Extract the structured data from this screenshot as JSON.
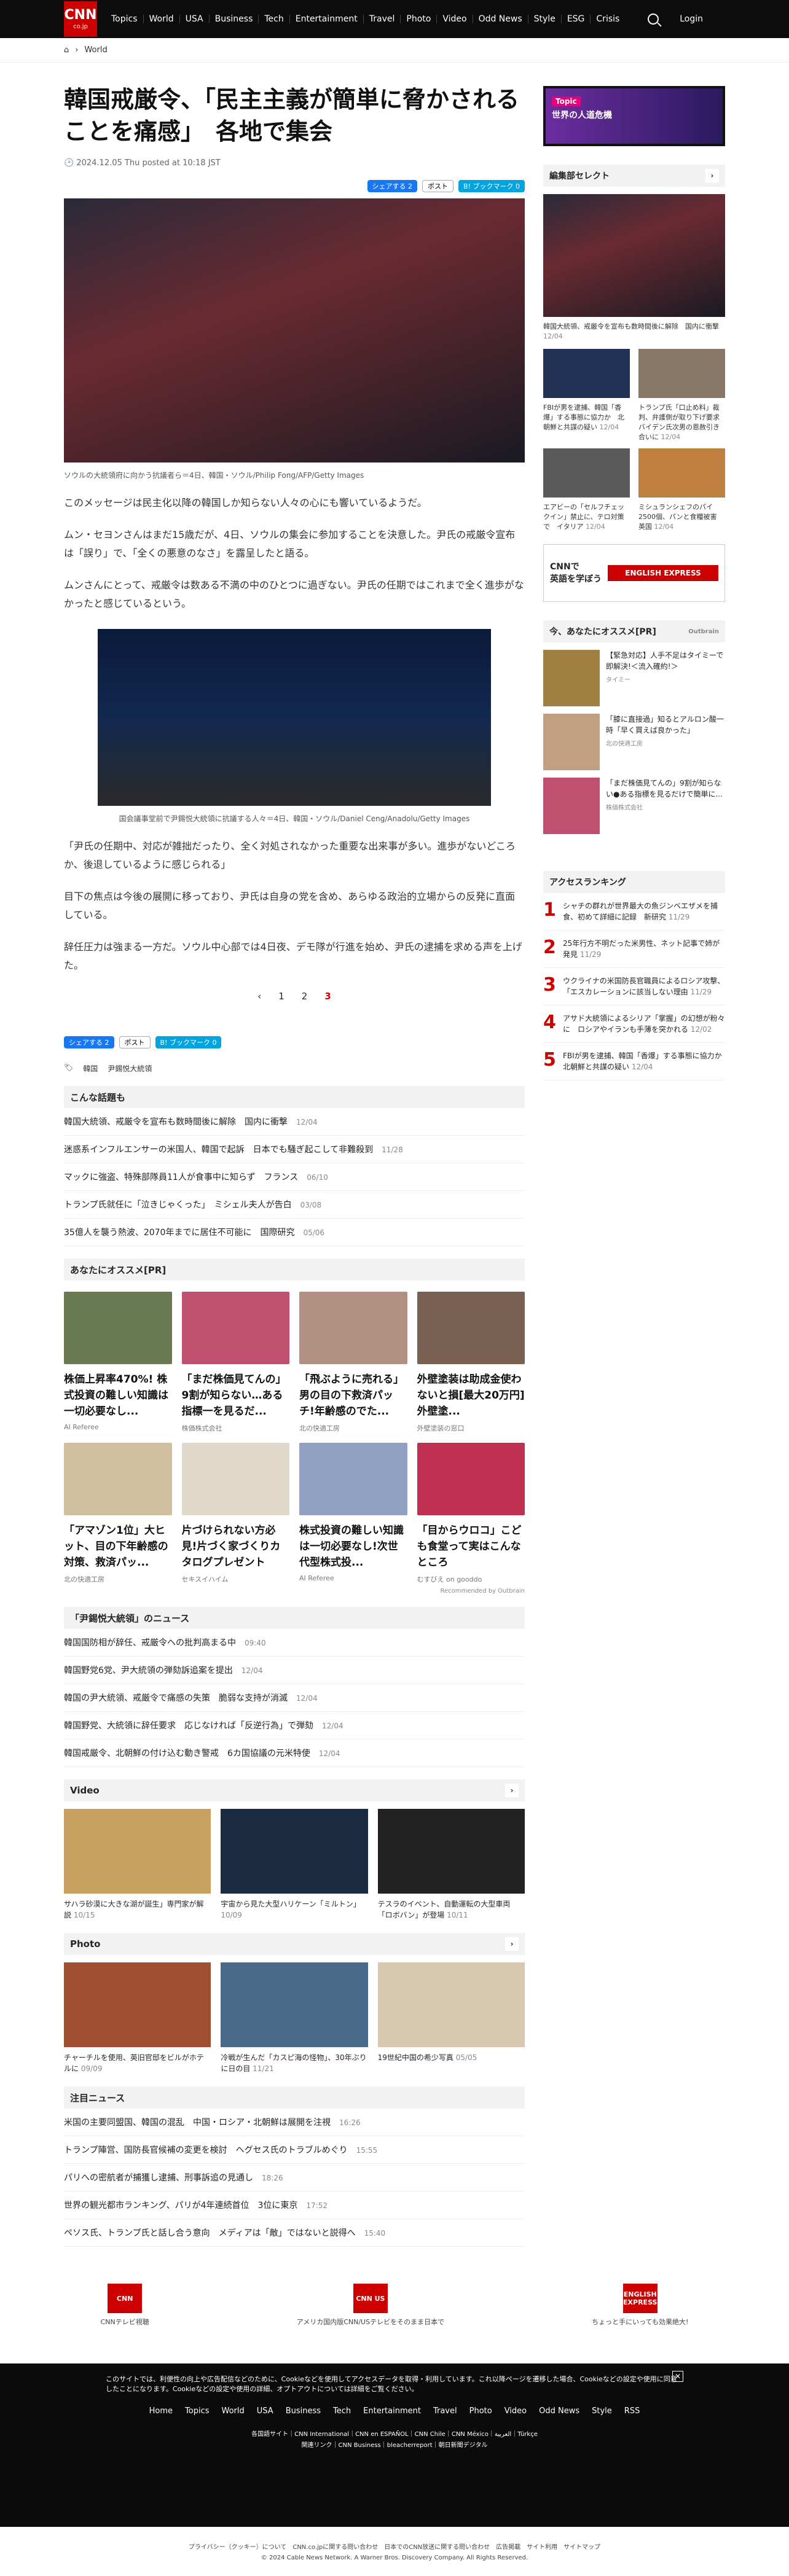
{
  "header": {
    "logo": "CNN",
    "logo_sub": "co.jp",
    "nav": [
      "Topics",
      "World",
      "USA",
      "Business",
      "Tech",
      "Entertainment",
      "Travel",
      "Photo",
      "Video",
      "Odd News",
      "Style",
      "ESG",
      "Crisis"
    ],
    "login": "Login"
  },
  "breadcrumb": {
    "section": "World"
  },
  "article": {
    "title": "韓国戒厳令、「民主主義が簡単に脅かされることを痛感」　各地で集会",
    "date": "2024.12.05 Thu posted at 10:18 JST",
    "share": {
      "fb": "シェアする 2",
      "x": "ポスト",
      "hb": "B! ブックマーク 0"
    },
    "photo1_caption": "ソウルの大統領府に向かう抗議者ら＝4日、韓国・ソウル/Philip Fong/AFP/Getty Images",
    "paras": [
      "このメッセージは民主化以降の韓国しか知らない人々の心にも響いているようだ。",
      "ムン・セヨンさんはまだ15歳だが、4日、ソウルの集会に参加することを決意した。尹氏の戒厳令宣布は「誤り」で、「全くの悪意のなさ」を露呈したと語る。",
      "ムンさんにとって、戒厳令は数ある不満の中のひとつに過ぎない。尹氏の任期ではこれまで全く進歩がなかったと感じているという。"
    ],
    "photo2_caption": "国会議事堂前で尹錫悦大統領に抗議する人々＝4日、韓国・ソウル/Daniel Ceng/Anadolu/Getty Images",
    "paras2": [
      "「尹氏の任期中、対応が雑拙だったり、全く対処されなかった重要な出来事が多い。進歩がないどころか、後退しているように感じられる」",
      "目下の焦点は今後の展開に移っており、尹氏は自身の党を含め、あらゆる政治的立場からの反発に直面している。",
      "辞任圧力は強まる一方だ。ソウル中心部では4日夜、デモ隊が行進を始め、尹氏の逮捕を求める声を上げた。"
    ],
    "pager": [
      "‹",
      "1",
      "2",
      "3"
    ],
    "tags": [
      "韓国",
      "尹錫悦大統領"
    ]
  },
  "related": {
    "title": "こんな話題も",
    "items": [
      {
        "t": "韓国大統領、戒厳令を宣布も数時間後に解除　国内に衝撃",
        "d": "12/04"
      },
      {
        "t": "迷惑系インフルエンサーの米国人、韓国で起訴　日本でも騒ぎ起こして非難殺到",
        "d": "11/28"
      },
      {
        "t": "マックに強盗、特殊部隊員11人が食事中に知らず　フランス",
        "d": "06/10"
      },
      {
        "t": "トランプ氏就任に「泣きじゃくった」　ミシェル夫人が告白",
        "d": "03/08"
      },
      {
        "t": "35億人を襲う熱波、2070年までに居住不可能に　国際研究",
        "d": "05/06"
      }
    ]
  },
  "pr": {
    "title": "あなたにオススメ[PR]",
    "cards": [
      {
        "t": "株価上昇率470%! 株式投資の難しい知識は一切必要なし...",
        "s": "AI Referee"
      },
      {
        "t": "「まだ株価見てんの」9割が知らない…ある指標一を見るだ...",
        "s": "株価株式会社"
      },
      {
        "t": "「飛ぶように売れる」男の目の下救済パッチ!年齢感のでた...",
        "s": "北の快適工房"
      },
      {
        "t": "外壁塗装は助成金使わないと損[最大20万円]外壁塗...",
        "s": "外壁塗装の窓口"
      },
      {
        "t": "「アマゾン1位」大ヒット、目の下年齢感の対策、救済パッ...",
        "s": "北の快適工房"
      },
      {
        "t": "片づけられない方必見!片づく家づくりカタログプレゼント",
        "s": "セキスイハイム"
      },
      {
        "t": "株式投資の難しい知識は一切必要なし!次世代型株式投...",
        "s": "AI Referee"
      },
      {
        "t": "「目からウロコ」こども食堂って実はこんなところ",
        "s": "むすびえ on gooddo"
      }
    ],
    "rec": "Recommended by Outbrain"
  },
  "yoon": {
    "title": "「尹錫悦大統領」のニュース",
    "items": [
      {
        "t": "韓国国防相が辞任、戒厳令への批判高まる中",
        "d": "09:40"
      },
      {
        "t": "韓国野党6党、尹大統領の弾劾訴追案を提出",
        "d": "12/04"
      },
      {
        "t": "韓国の尹大統領、戒厳令で痛感の失策　脆弱な支持が消滅",
        "d": "12/04"
      },
      {
        "t": "韓国野党、大統領に辞任要求　応じなければ「反逆行為」で弾劾",
        "d": "12/04"
      },
      {
        "t": "韓国戒厳令、北朝鮮の付け込む動き警戒　6カ国協議の元米特使",
        "d": "12/04"
      }
    ]
  },
  "video": {
    "title": "Video",
    "items": [
      {
        "t": "サハラ砂漠に大きな湖が誕生」専門家が解説",
        "d": "10/15"
      },
      {
        "t": "宇宙から見た大型ハリケーン「ミルトン」",
        "d": "10/09"
      },
      {
        "t": "テスラのイベント、自動運転の大型車両「ロボバン」が登場",
        "d": "10/11"
      }
    ]
  },
  "photo": {
    "title": "Photo",
    "items": [
      {
        "t": "チャーチルを使用、英旧官邸をビルがホテルに",
        "d": "09/09"
      },
      {
        "t": "冷戦が生んだ「カスピ海の怪物」、30年ぶりに日の目",
        "d": "11/21"
      },
      {
        "t": "19世紀中国の希少写真",
        "d": "05/05"
      }
    ]
  },
  "notable": {
    "title": "注目ニュース",
    "items": [
      {
        "t": "米国の主要同盟国、韓国の混乱　中国・ロシア・北朝鮮は展開を注視",
        "d": "16:26"
      },
      {
        "t": "トランプ陣営、国防長官候補の変更を検討　ヘグセス氏のトラブルめぐり",
        "d": "15:55"
      },
      {
        "t": "パリへの密航者が捕獲し逮捕、刑事訴追の見通し",
        "d": "18:26"
      },
      {
        "t": "世界の観光都市ランキング、パリが4年連続首位　3位に東京",
        "d": "17:52"
      },
      {
        "t": "ペソス氏、トランプ氏と話し合う意向　メディアは「敵」ではないと説得へ",
        "d": "15:40"
      }
    ]
  },
  "footer_icons": [
    {
      "lg": "CNN",
      "t": "CNNテレビ視聴"
    },
    {
      "lg": "CNN US",
      "t": "アメリカ国内版CNN/USテレビをそのまま日本で"
    },
    {
      "lg": "ENGLISH EXPRESS",
      "t": "ちょっと手にいっても効果絶大!"
    }
  ],
  "side": {
    "topic_tag": "Topic",
    "topic_title": "世界の人道危機",
    "editor_title": "編集部セレクト",
    "editor_big": "韓国大統領、戒厳令を宣布も数時間後に解除　国内に衝撃",
    "editor_big_d": "12/04",
    "editor_items": [
      {
        "t": "FBIが男を逮捕、韓国「香爆」する事態に協力か　北朝鮮と共謀の疑い",
        "d": "12/04"
      },
      {
        "t": "トランプ氏「口止め料」裁判、弁護側が取り下げ要求　バイデン氏次男の恩赦引き合いに",
        "d": "12/04"
      },
      {
        "t": "エアビーの「セルフチェックイン」禁止に、テロ対策で　イタリア",
        "d": "12/04"
      },
      {
        "t": "ミシュランシェフのパイ2500個、パンと食糧被害　英国",
        "d": "12/04"
      }
    ],
    "engl_a": "CNNで",
    "engl_b": "英語を学ぼう",
    "engl_logo": "ENGLISH EXPRESS",
    "pr_title": "今、あなたにオススメ[PR]",
    "pr_rec": "Outbrain",
    "pr_items": [
      {
        "t": "【緊急対応】人手不足はタイミーで即解決!＜流入確約!＞",
        "s": "タイミー"
      },
      {
        "t": "「膝に直接過」知るとアルロン酸一時「早く買えば良かった」",
        "s": "北の快適工房"
      },
      {
        "t": "「まだ株価見てんの」9割が知らない●ある指標を見るだけで簡単に...",
        "s": "株価株式会社"
      }
    ],
    "rank_title": "アクセスランキング",
    "rank": [
      {
        "n": "1",
        "t": "シャチの群れが世界最大の魚ジンベエザメを捕食、初めて詳細に記録　新研究",
        "d": "11/29"
      },
      {
        "n": "2",
        "t": "25年行方不明だった米男性、ネット記事で姉が発見",
        "d": "11/29"
      },
      {
        "n": "3",
        "t": "ウクライナの米国防長官職員によるロシア攻撃、「エスカレーションに該当しない理由",
        "d": "11/29"
      },
      {
        "n": "4",
        "t": "アサド大統領によるシリア「掌握」の幻想が粉々に　ロシアやイランも手薄を突かれる",
        "d": "12/02"
      },
      {
        "n": "5",
        "t": "FBIが男を逮捕、韓国「香爆」する事態に協力か　北朝鮮と共謀の疑い",
        "d": "12/04"
      }
    ]
  },
  "cookie": {
    "msg": "このサイトでは、利便性の向上や広告配信などのために、Cookieなどを使用してアクセスデータを取得・利用しています。これ以降ページを遷移した場合、Cookieなどの設定や使用に同意したことになります。Cookieなどの設定や使用の詳細、オプトアウトについては詳細をご覧ください。",
    "close": "✕"
  },
  "footer": {
    "nav": [
      "Home",
      "Topics",
      "World",
      "USA",
      "Business",
      "Tech",
      "Entertainment",
      "Travel",
      "Photo",
      "Video",
      "Odd News",
      "Style",
      "RSS"
    ],
    "links1": "各国語サイト｜CNN International｜CNN en ESPAÑOL｜CNN Chile｜CNN México｜العربية｜Türkçe",
    "links2": "関連リンク｜CNN Business｜bleacherreport｜朝日新聞デジタル",
    "links3": "プライバシー（クッキー）について　CNN.co.jpに関する問い合わせ　日本でのCNN放送に関する問い合わせ　広告掲載　サイト利用　サイトマップ",
    "copy": "© 2024 Cable News Network. A Warner Bros. Discovery Company. All Rights Reserved."
  },
  "colors": {
    "brand": "#cc0000",
    "dark": "#0c0c0c"
  }
}
